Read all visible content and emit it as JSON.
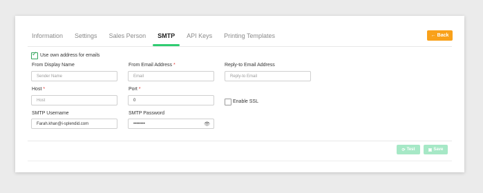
{
  "tabs": [
    {
      "label": "Information",
      "active": false
    },
    {
      "label": "Settings",
      "active": false
    },
    {
      "label": "Sales Person",
      "active": false
    },
    {
      "label": "SMTP",
      "active": true
    },
    {
      "label": "API Keys",
      "active": false
    },
    {
      "label": "Printing Templates",
      "active": false
    }
  ],
  "back_button": {
    "icon": "arrow-left-icon",
    "arrow": "←",
    "label": "Back"
  },
  "use_own_address": {
    "label": "Use own address for emails",
    "checked": true
  },
  "fields": {
    "from_display_name": {
      "label": "From Display Name",
      "required": false,
      "value": "",
      "placeholder": "Sender Name"
    },
    "from_email": {
      "label": "From Email Address",
      "required": true,
      "value": "",
      "placeholder": "Email"
    },
    "reply_to": {
      "label": "Reply-to Email Address",
      "required": false,
      "value": "",
      "placeholder": "Reply-to Email"
    },
    "host": {
      "label": "Host",
      "required": true,
      "value": "",
      "placeholder": "Host"
    },
    "port": {
      "label": "Port",
      "required": true,
      "value": "0"
    },
    "smtp_username": {
      "label": "SMTP Username",
      "required": false,
      "value": "Farah.khan@i-splendid.com"
    },
    "smtp_password": {
      "label": "SMTP Password",
      "required": false,
      "value": "••••••••",
      "icon": "eye-icon"
    }
  },
  "enable_ssl": {
    "label": "Enable SSL",
    "checked": false
  },
  "required_marker": "*",
  "actions": {
    "test": {
      "icon": "test-icon",
      "label": "Test"
    },
    "save": {
      "icon": "save-icon",
      "label": "Save"
    }
  },
  "colors": {
    "accent": "#2fcc71",
    "back": "#f9a11a",
    "action_disabled": "#a6e8c6",
    "required": "#e53935"
  }
}
